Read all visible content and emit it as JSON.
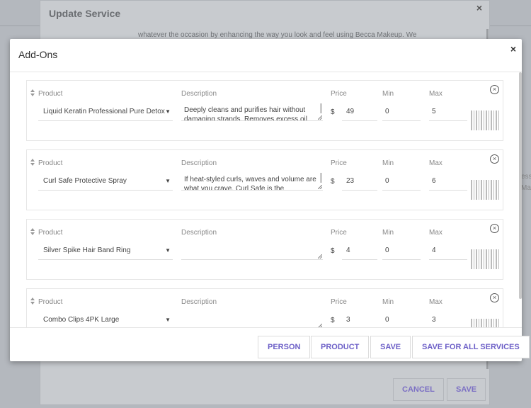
{
  "background": {
    "side_text_1": "ess",
    "side_text_2": "Ma"
  },
  "update_service": {
    "title": "Update Service",
    "close_label": "×",
    "description_snippet": "whatever the occasion by enhancing the way you look and feel using Becca Makeup. We",
    "cancel_label": "CANCEL",
    "save_label": "SAVE"
  },
  "addons_modal": {
    "title": "Add-Ons",
    "close_label": "×",
    "columns": {
      "product": "Product",
      "description": "Description",
      "price": "Price",
      "min": "Min",
      "max": "Max"
    },
    "currency_symbol": "$",
    "rows": [
      {
        "product": "Liquid Keratin Professional Pure Detox Shampoo",
        "description": "Deeply cleans and purifies hair without damaging strands. Removes excess oil",
        "price": "49",
        "min": "0",
        "max": "5"
      },
      {
        "product": "Curl Safe Protective Spray",
        "description": "If heat-styled curls, waves and volume are what you crave, Curl Safe is the",
        "price": "23",
        "min": "0",
        "max": "6"
      },
      {
        "product": "Silver Spike Hair Band Ring",
        "description": "",
        "price": "4",
        "min": "0",
        "max": "4"
      },
      {
        "product": "Combo Clips 4PK Large",
        "description": "",
        "price": "3",
        "min": "0",
        "max": "3"
      }
    ],
    "footer": {
      "person": "PERSON",
      "product": "PRODUCT",
      "save": "SAVE",
      "save_all": "SAVE FOR ALL SERVICES"
    }
  },
  "colors": {
    "accent": "#6c5fc7",
    "overlay": "#b4b8be"
  }
}
